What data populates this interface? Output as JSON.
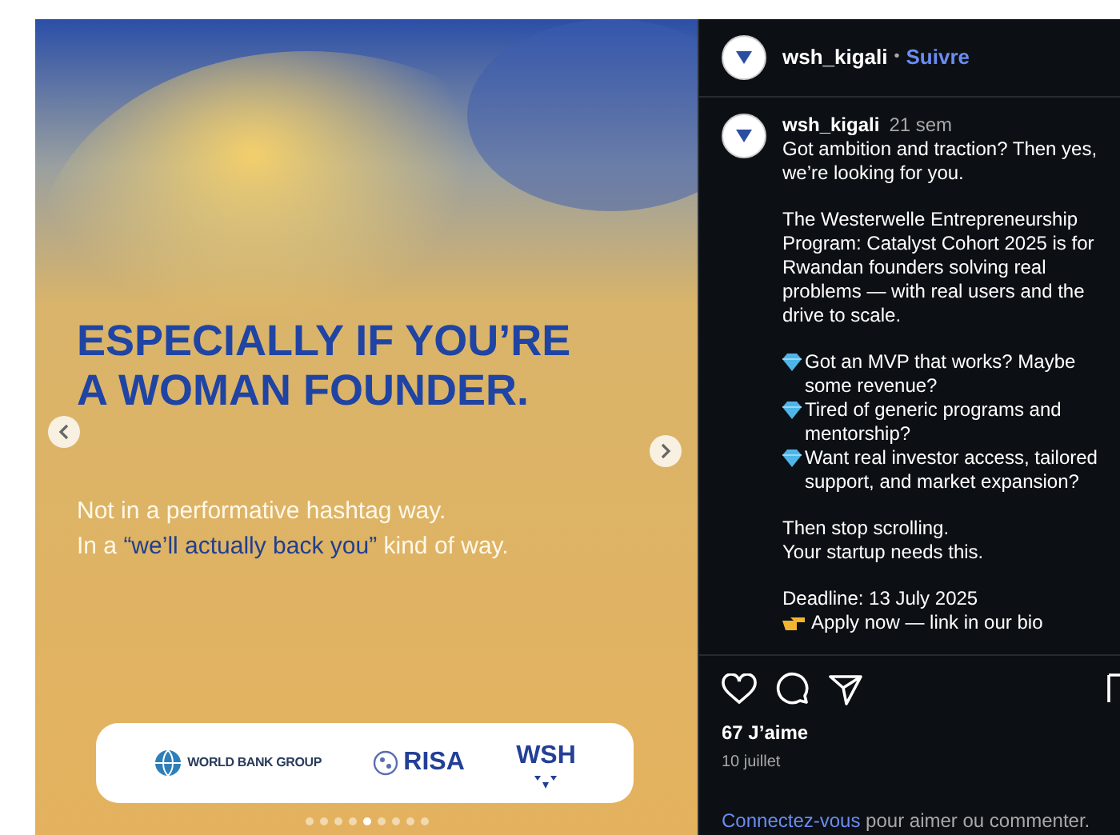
{
  "slide": {
    "headline": [
      "ESPECIALLY IF YOU’RE",
      "A WOMAN FOUNDER."
    ],
    "subtitle": [
      [
        {
          "text": "Not in a performative hashtag way.",
          "highlight": false
        }
      ],
      [
        {
          "text": "In a ",
          "highlight": false
        },
        {
          "text": "“we’ll actually back you”",
          "highlight": true
        },
        {
          "text": " kind of way.",
          "highlight": false
        }
      ]
    ],
    "logos": [
      {
        "kind": "globe",
        "text": "WORLD BANK GROUP"
      },
      {
        "kind": "risa",
        "text": "RISA"
      },
      {
        "kind": "wsh",
        "text": "WSH"
      }
    ],
    "dots": [
      {
        "selected": false
      },
      {
        "selected": false
      },
      {
        "selected": false
      },
      {
        "selected": false
      },
      {
        "selected": true
      },
      {
        "selected": false
      },
      {
        "selected": false
      },
      {
        "selected": false
      },
      {
        "selected": false
      }
    ]
  },
  "header": {
    "username": "wsh_kigali",
    "separator": "•",
    "follow": "Suivre"
  },
  "caption": {
    "username": "wsh_kigali",
    "time": "21 sem",
    "paragraphs": [
      [
        {
          "kind": "plain",
          "text": "Got ambition and traction? Then yes, we’re looking for you."
        }
      ],
      [
        {
          "kind": "plain",
          "text": "The Westerwelle Entrepreneurship Program: Catalyst Cohort 2025 is for Rwandan founders solving real problems — with real users and the drive to scale."
        }
      ],
      [
        {
          "kind": "gem",
          "text": "Got an MVP that works? Maybe some revenue?"
        },
        {
          "kind": "gem",
          "text": "Tired of generic programs and mentorship?"
        },
        {
          "kind": "gem",
          "text": "Want real investor access, tailored support, and market expansion?"
        }
      ],
      [
        {
          "kind": "plain",
          "text": "Then stop scrolling."
        },
        {
          "kind": "plain",
          "text": "Your startup needs this."
        }
      ],
      [
        {
          "kind": "plain",
          "text": "Deadline: 13 July 2025"
        },
        {
          "kind": "hand",
          "text": "Apply now — link in our bio"
        }
      ]
    ]
  },
  "likes": "67 J’aime",
  "date": "10 juillet",
  "login": {
    "link": "Connectez-vous",
    "text": " pour aimer ou commenter."
  }
}
